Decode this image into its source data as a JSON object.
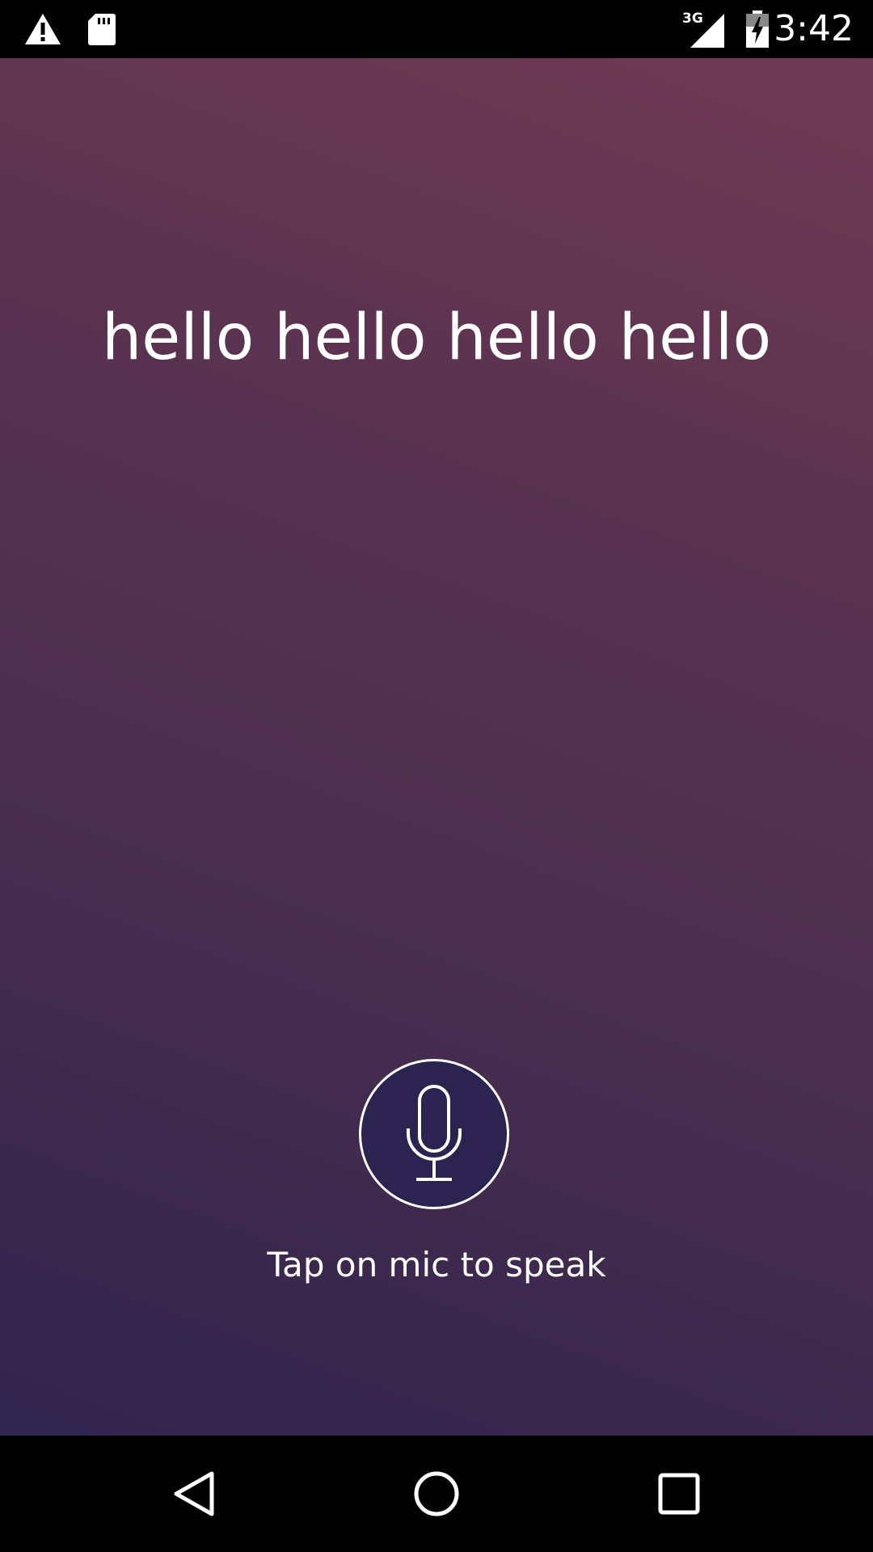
{
  "status_bar": {
    "time": "3:42",
    "network_label": "3G",
    "icons": [
      "warning-icon",
      "sd-card-icon",
      "signal-icon",
      "battery-charging-icon"
    ]
  },
  "main": {
    "transcript": "hello hello hello hello",
    "mic_icon": "microphone-icon",
    "hint": "Tap on mic to speak"
  },
  "nav_bar": {
    "icons": [
      "back-icon",
      "home-icon",
      "recents-icon"
    ]
  },
  "colors": {
    "gradient_top": "#6f3a52",
    "gradient_bottom": "#302550",
    "mic_fill": "#2c2350",
    "text": "#ffffff"
  }
}
